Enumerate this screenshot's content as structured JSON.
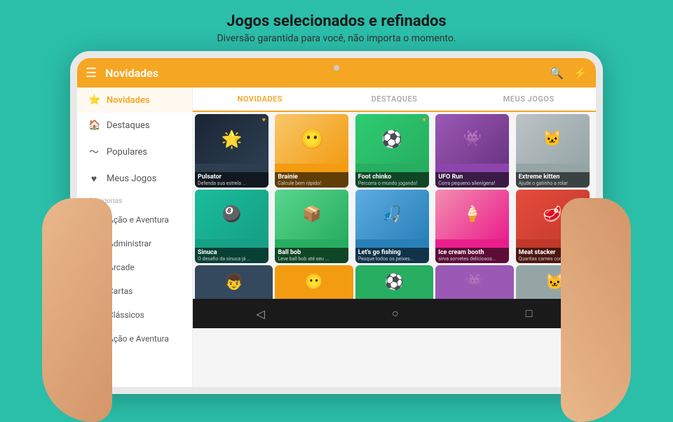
{
  "hero": {
    "title": "Jogos selecionados e refinados",
    "subtitle": "Diversão garantida para você,  não importa o momento."
  },
  "topbar": {
    "title": "Novidades",
    "search_icon": "🔍",
    "flash_icon": "⚡"
  },
  "tabs": [
    {
      "label": "NOVIDADES",
      "active": true
    },
    {
      "label": "DESTAQUES",
      "active": false
    },
    {
      "label": "MEUS JOGOS",
      "active": false
    }
  ],
  "sidebar": {
    "nav": [
      {
        "label": "Novidades",
        "icon": "⭐",
        "active": true
      },
      {
        "label": "Destaques",
        "icon": "🏠",
        "active": false
      },
      {
        "label": "Populares",
        "icon": "📈",
        "active": false
      },
      {
        "label": "Meus Jogos",
        "icon": "♥",
        "active": false
      }
    ],
    "category_label": "Categorias",
    "categories": [
      {
        "label": "Ação e Aventura",
        "color": "#e74c3c"
      },
      {
        "label": "Administrar",
        "color": "#3498db"
      },
      {
        "label": "Arcade",
        "color": "#9b59b6"
      },
      {
        "label": "Cartas",
        "color": "#e67e22"
      },
      {
        "label": "Clássicos",
        "color": "#2ecc71"
      },
      {
        "label": "Ação e Aventura",
        "color": "#e74c3c"
      }
    ]
  },
  "games_row1": [
    {
      "title": "Pulsator",
      "desc": "Defenda sua estrela ...",
      "bg": "#2c3e50",
      "emoji": "🌟",
      "heart": true
    },
    {
      "title": "Brainie",
      "desc": "Calcule bem rápido!",
      "bg": "#f39c12",
      "emoji": "😐",
      "heart": false
    },
    {
      "title": "Foot chinko",
      "desc": "Percorra o mundo jogando!",
      "bg": "#27ae60",
      "emoji": "⚽",
      "heart": true
    },
    {
      "title": "UFO Run",
      "desc": "Corra pequeno alienígena!",
      "bg": "#8e44ad",
      "emoji": "👾",
      "heart": false
    },
    {
      "title": "Extreme kitten",
      "desc": "Ajude o gatinho a rolar",
      "bg": "#bdc3c7",
      "emoji": "🐱",
      "heart": false
    }
  ],
  "games_row2": [
    {
      "title": "Sinuca",
      "desc": "O desafio da sinuca já ...",
      "bg": "#16a085",
      "emoji": "🎱",
      "heart": false
    },
    {
      "title": "Ball bob",
      "desc": "Leve ball bob até seu ...",
      "bg": "#27ae60",
      "emoji": "📦",
      "heart": false
    },
    {
      "title": "Let's go fishing",
      "desc": "Pesque todos os peixes...",
      "bg": "#2980b9",
      "emoji": "🎣",
      "heart": false
    },
    {
      "title": "Ice cream booth",
      "desc": "sirva sorvetes deliciosos...",
      "bg": "#e91e8c",
      "emoji": "🍦",
      "heart": false
    },
    {
      "title": "Meat stacker",
      "desc": "Quaritas carnes consegue...",
      "bg": "#e74c3c",
      "emoji": "🥩",
      "heart": false
    }
  ],
  "games_row3": [
    {
      "title": "",
      "desc": "",
      "bg": "#34495e",
      "emoji": "👦",
      "heart": false
    },
    {
      "title": "",
      "desc": "",
      "bg": "#f39c12",
      "emoji": "😐",
      "heart": false
    },
    {
      "title": "",
      "desc": "",
      "bg": "#27ae60",
      "emoji": "⚽",
      "heart": false
    },
    {
      "title": "",
      "desc": "",
      "bg": "#8e44ad",
      "emoji": "👾",
      "heart": false
    },
    {
      "title": "",
      "desc": "",
      "bg": "#bdc3c7",
      "emoji": "🐱",
      "heart": false
    }
  ],
  "bottom_nav": {
    "back": "◁",
    "home": "○",
    "square": "□"
  }
}
